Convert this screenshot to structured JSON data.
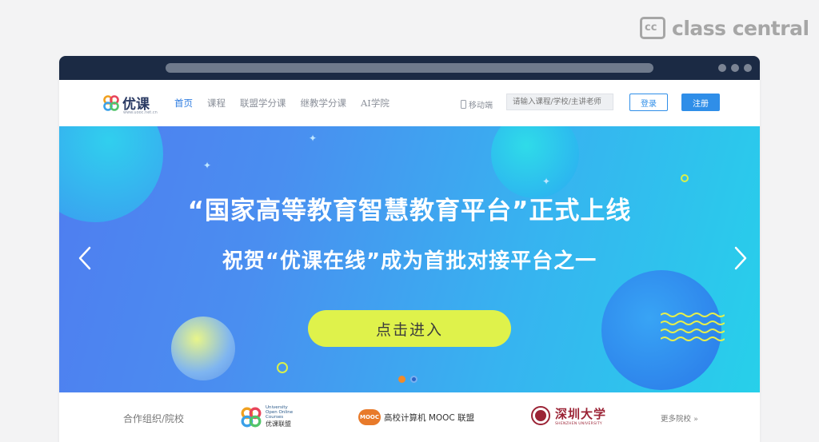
{
  "watermark": {
    "brand_text": "class central",
    "badge": "cc"
  },
  "site": {
    "logo_text": "优课",
    "logo_sub": "www.uooc.net.cn",
    "nav": [
      {
        "label": "首页",
        "active": true
      },
      {
        "label": "课程",
        "active": false
      },
      {
        "label": "联盟学分课",
        "active": false
      },
      {
        "label": "继教学分课",
        "active": false
      },
      {
        "label": "AI学院",
        "active": false
      }
    ],
    "mobile_label": "移动端",
    "search_placeholder": "请输入课程/学校/主讲老师",
    "login_label": "登录",
    "register_label": "注册"
  },
  "banner": {
    "headline": "“国家高等教育智慧教育平台”正式上线",
    "subheadline": "祝贺“优课在线”成为首批对接平台之一",
    "cta_label": "点击进入",
    "slide_count": 2,
    "active_slide": 1
  },
  "partners": {
    "label": "合作组织/院校",
    "uoc_en": "University Open Online Courses",
    "uoc_cn": "优课联盟",
    "mooc_badge": "MOOC",
    "mooc_label": "高校计算机 MOOC 联盟",
    "szu_cn": "深圳大学",
    "szu_en": "SHENZHEN UNIVERSITY",
    "more_label": "更多院校 »"
  },
  "colors": {
    "accent": "#2f8ee8",
    "cta": "#dff24b",
    "titlebar": "#1b2a44"
  }
}
